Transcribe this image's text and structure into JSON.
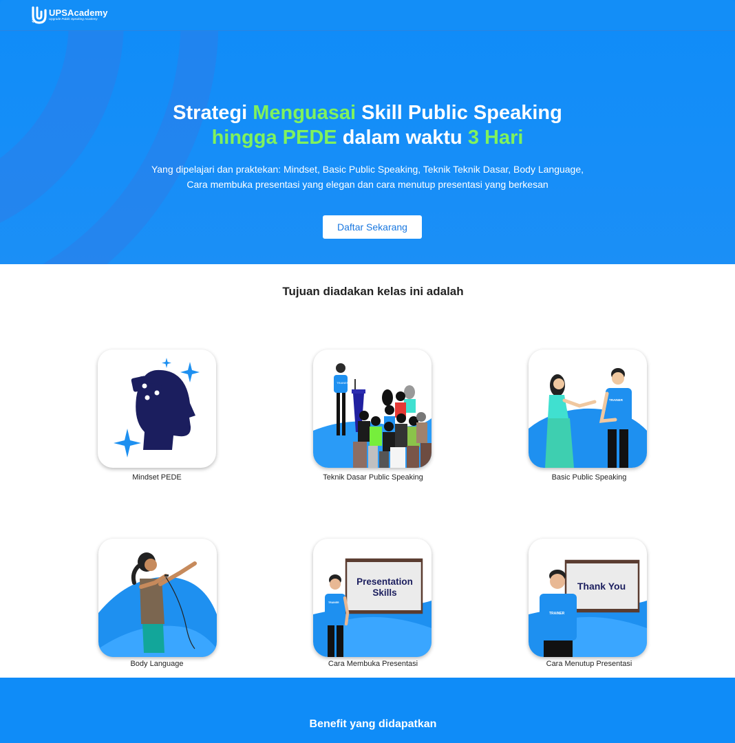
{
  "brand": {
    "name": "UPSAcademy",
    "tagline": "Upgrade Public Speaking Academy",
    "icon": "ups-logo-icon"
  },
  "hero": {
    "title_line1": [
      {
        "text": "Strategi ",
        "highlight": false
      },
      {
        "text": "Menguasai",
        "highlight": true
      },
      {
        "text": " Skill Public Speaking",
        "highlight": false
      }
    ],
    "title_line2": [
      {
        "text": "hingga PEDE",
        "highlight": true
      },
      {
        "text": " dalam waktu ",
        "highlight": false
      },
      {
        "text": "3 Hari",
        "highlight": true
      }
    ],
    "subtitle_line1": "Yang dipelajari dan praktekan: Mindset, Basic Public Speaking, Teknik Teknik Dasar, Body Language,",
    "subtitle_line2": "Cara membuka presentasi yang elegan dan cara menutup presentasi yang berkesan",
    "cta_label": "Daftar Sekarang"
  },
  "goals": {
    "title": "Tujuan diadakan kelas ini adalah",
    "items": [
      {
        "label": "Mindset PEDE",
        "icon": "mindset-head-puzzle-icon"
      },
      {
        "label": "Teknik Dasar Public Speaking",
        "icon": "speaker-podium-audience-icon"
      },
      {
        "label": "Basic Public Speaking",
        "icon": "trainer-conversation-icon"
      },
      {
        "label": "Body Language",
        "icon": "woman-microphone-icon"
      },
      {
        "label": "Cara Membuka Presentasi",
        "icon": "presentation-board-icon",
        "board_text_1": "Presentation",
        "board_text_2": "Skills"
      },
      {
        "label": "Cara Menutup Presentasi",
        "icon": "thank-you-board-icon",
        "board_text_1": "Thank You"
      }
    ],
    "shirt_text": "TRAINER"
  },
  "benefit": {
    "title": "Benefit yang didapatkan"
  },
  "colors": {
    "primary_blue": "#138ef7",
    "highlight_green": "#80f25d",
    "navy": "#1b1e5e",
    "white": "#ffffff"
  }
}
